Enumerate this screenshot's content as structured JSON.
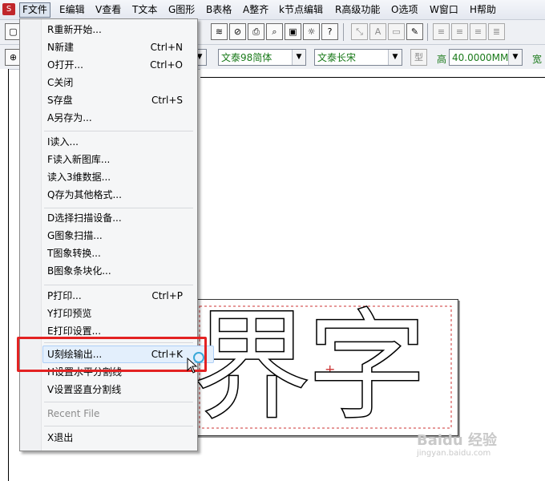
{
  "app_icon_letter": "S",
  "menubar": [
    {
      "label": "F文件",
      "active": true
    },
    {
      "label": "E编辑"
    },
    {
      "label": "V查看"
    },
    {
      "label": "T文本"
    },
    {
      "label": "G图形"
    },
    {
      "label": "B表格"
    },
    {
      "label": "A整齐"
    },
    {
      "label": "k节点编辑"
    },
    {
      "label": "R高级功能"
    },
    {
      "label": "O选项"
    },
    {
      "label": "W窗口"
    },
    {
      "label": "H帮助"
    }
  ],
  "toolbar": {
    "font_name": "文泰98简体",
    "font_style": "文泰长宋",
    "type_button": "型",
    "height_label": "高",
    "height_value": "40.0000MM",
    "width_label": "宽"
  },
  "file_menu": [
    {
      "label": "R重新开始...",
      "shortcut": ""
    },
    {
      "label": "N新建",
      "shortcut": "Ctrl+N"
    },
    {
      "label": "O打开...",
      "shortcut": "Ctrl+O"
    },
    {
      "label": "C关闭",
      "shortcut": ""
    },
    {
      "label": "S存盘",
      "shortcut": "Ctrl+S"
    },
    {
      "label": "A另存为...",
      "shortcut": ""
    },
    {
      "label": "I读入...",
      "shortcut": ""
    },
    {
      "label": "F读入新图库...",
      "shortcut": ""
    },
    {
      "label": "读入3维数据...",
      "shortcut": ""
    },
    {
      "label": "Q存为其他格式...",
      "shortcut": ""
    },
    {
      "label": "D选择扫描设备...",
      "shortcut": ""
    },
    {
      "label": "G图象扫描...",
      "shortcut": ""
    },
    {
      "label": "T图象转换...",
      "shortcut": ""
    },
    {
      "label": "B图象条块化...",
      "shortcut": ""
    },
    {
      "label": "P打印...",
      "shortcut": "Ctrl+P"
    },
    {
      "label": "Y打印预览",
      "shortcut": ""
    },
    {
      "label": "E打印设置...",
      "shortcut": ""
    },
    {
      "label": "U刻绘输出...",
      "shortcut": "Ctrl+K",
      "highlighted": true
    },
    {
      "label": "H设置水平分割线",
      "shortcut": ""
    },
    {
      "label": "V设置竖直分割线",
      "shortcut": ""
    },
    {
      "label": "Recent File",
      "shortcut": "",
      "disabled": true
    },
    {
      "label": "X退出",
      "shortcut": ""
    }
  ],
  "canvas_text": "界字",
  "watermark": {
    "brand": "Baidu 经验",
    "url": "jingyan.baidu.com"
  }
}
